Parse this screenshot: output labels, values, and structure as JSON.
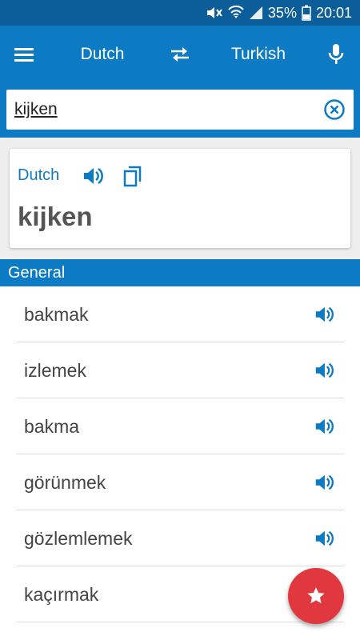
{
  "status": {
    "battery": "35%",
    "time": "20:01"
  },
  "appbar": {
    "source_lang": "Dutch",
    "target_lang": "Turkish"
  },
  "search": {
    "value": "kijken"
  },
  "card": {
    "lang": "Dutch",
    "word": "kijken"
  },
  "section": {
    "title": "General"
  },
  "results": [
    {
      "text": "bakmak"
    },
    {
      "text": "izlemek"
    },
    {
      "text": "bakma"
    },
    {
      "text": "görünmek"
    },
    {
      "text": "gözlemlemek"
    },
    {
      "text": "kaçırmak"
    }
  ],
  "colors": {
    "primary": "#0d7bc4",
    "status": "#0b5e99",
    "fab": "#e0383e"
  },
  "icons": [
    "mute-icon",
    "wifi-icon",
    "signal-icon",
    "battery-icon",
    "menu-icon",
    "swap-icon",
    "microphone-icon",
    "clear-icon",
    "speaker-icon",
    "copy-icon",
    "star-icon"
  ]
}
